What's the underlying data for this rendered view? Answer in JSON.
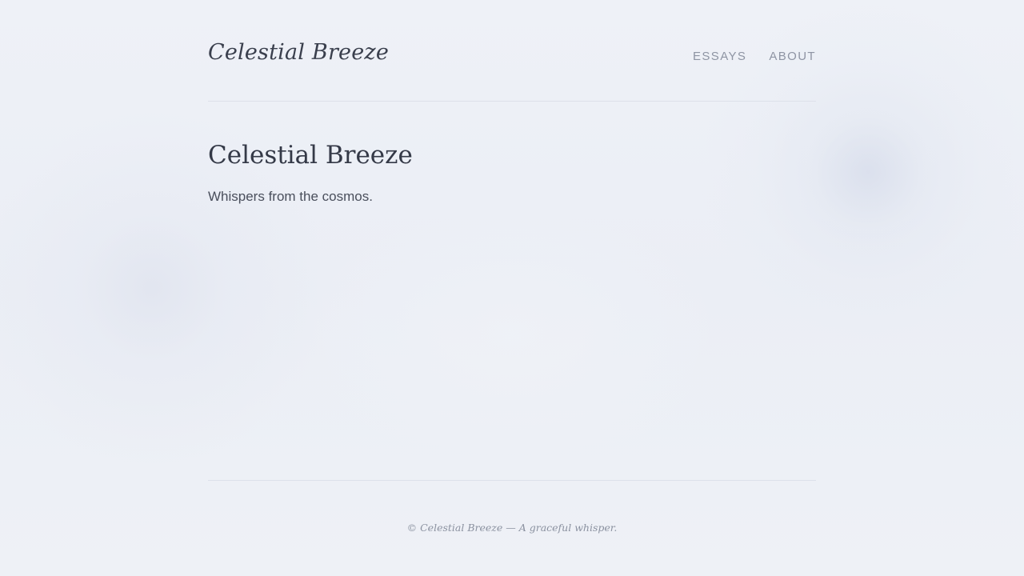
{
  "header": {
    "brand": "Celestial Breeze",
    "nav": [
      {
        "label": "ESSAYS"
      },
      {
        "label": "ABOUT"
      }
    ]
  },
  "main": {
    "title": "Celestial Breeze",
    "tagline": "Whispers from the cosmos."
  },
  "footer": {
    "text": "© Celestial Breeze — A graceful whisper."
  },
  "colors": {
    "background": "#edf0f6",
    "text": "#2f3442",
    "muted": "#8e94a3",
    "rule": "#dde1ea"
  }
}
